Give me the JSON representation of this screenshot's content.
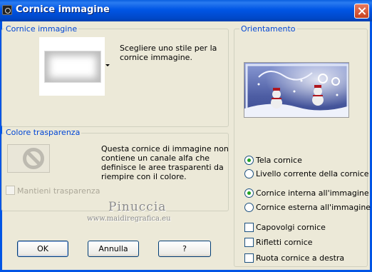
{
  "window": {
    "title": "Cornice immagine"
  },
  "frame_group": {
    "label": "Cornice immagine",
    "description_line1": "Scegliere uno stile per la",
    "description_line2": "cornice immagine."
  },
  "transparency_group": {
    "label": "Colore trasparenza",
    "description_line1": "Questa cornice di immagine non",
    "description_line2": "contiene un canale alfa che",
    "description_line3": "definisce le aree trasparenti da",
    "description_line4": "riempire con il colore.",
    "keep_transparency_label": "Mantieni trasparenza",
    "keep_transparency_checked": false,
    "keep_transparency_enabled": false
  },
  "orientation_group": {
    "label": "Orientamento",
    "radio_frame_target": [
      {
        "label": "Tela cornice",
        "checked": true
      },
      {
        "label": "Livello corrente della cornice",
        "checked": false
      }
    ],
    "radio_frame_position": [
      {
        "label": "Cornice interna all'immagine",
        "checked": true
      },
      {
        "label": "Cornice esterna all'immagine",
        "checked": false
      }
    ],
    "checkboxes": [
      {
        "label": "Capovolgi cornice",
        "checked": false
      },
      {
        "label": "Rifletti cornice",
        "checked": false
      },
      {
        "label": "Ruota cornice a destra",
        "checked": false
      }
    ]
  },
  "watermark": {
    "name": "Pinuccia",
    "site": "www.maidiregrafica.eu"
  },
  "buttons": {
    "ok": "OK",
    "cancel": "Annulla",
    "help": "?"
  },
  "colors": {
    "titlebar": "#0055E5",
    "group_label": "#0046D5",
    "dialog_bg": "#ECE9D8",
    "radio_dot": "#22A322"
  },
  "icons": {
    "app": "app-icon",
    "close": "close-icon",
    "no_symbol": "no-symbol-icon",
    "dropdown": "chevron-down-icon"
  }
}
